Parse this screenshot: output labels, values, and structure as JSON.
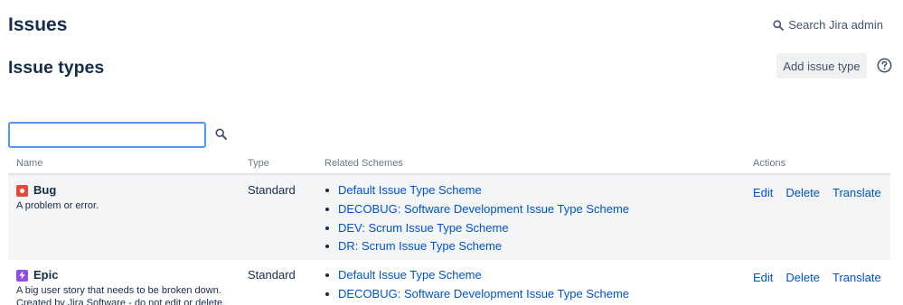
{
  "header": {
    "title": "Issues",
    "search_admin": "Search Jira admin"
  },
  "section": {
    "title": "Issue types",
    "add_button": "Add issue type"
  },
  "filter": {
    "value": "",
    "placeholder": ""
  },
  "table": {
    "headers": {
      "name": "Name",
      "type": "Type",
      "schemes": "Related Schemes",
      "actions": "Actions"
    },
    "rows": [
      {
        "name": "Bug",
        "icon": "bug-icon",
        "description": "A problem or error.",
        "type": "Standard",
        "schemes": [
          "Default Issue Type Scheme",
          "DECOBUG: Software Development Issue Type Scheme",
          "DEV: Scrum Issue Type Scheme",
          "DR: Scrum Issue Type Scheme"
        ],
        "actions": [
          "Edit",
          "Delete",
          "Translate"
        ]
      },
      {
        "name": "Epic",
        "icon": "epic-icon",
        "description_lines": [
          "A big user story that needs to be broken down.",
          "Created by Jira Software - do not edit or delete."
        ],
        "type": "Standard",
        "schemes": [
          "Default Issue Type Scheme",
          "DECOBUG: Software Development Issue Type Scheme"
        ],
        "actions": [
          "Edit",
          "Delete",
          "Translate"
        ]
      }
    ]
  },
  "colors": {
    "link": "#0052cc",
    "text": "#172b4d",
    "focus_border": "#4c9aff",
    "row_alt": "#f4f5f7",
    "bug": "#e5493a",
    "epic": "#904ee2"
  }
}
